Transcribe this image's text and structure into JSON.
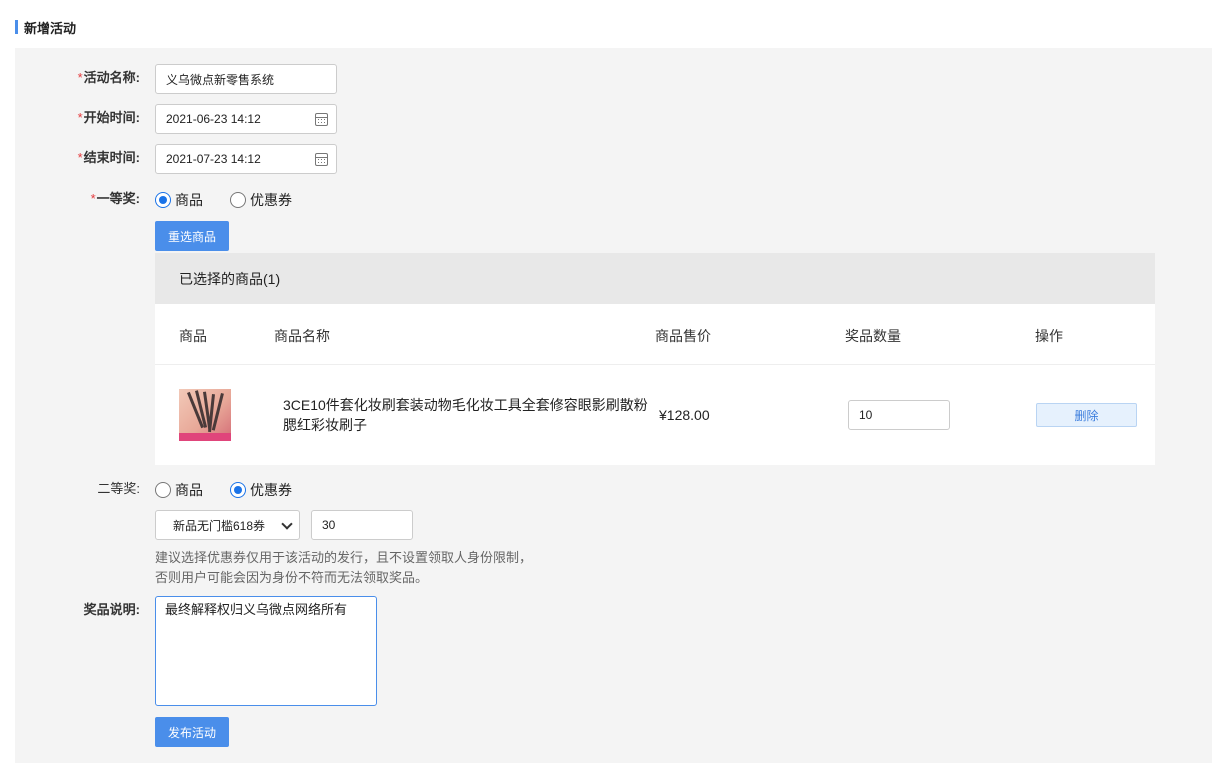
{
  "header": {
    "title": "新增活动"
  },
  "form": {
    "required_mark": "*",
    "name": {
      "label": "活动名称:",
      "value": "义乌微点新零售系统"
    },
    "start_time": {
      "label": "开始时间:",
      "value": "2021-06-23 14:12"
    },
    "end_time": {
      "label": "结束时间:",
      "value": "2021-07-23 14:12"
    },
    "first_prize": {
      "label": "一等奖:",
      "options": [
        "商品",
        "优惠券"
      ],
      "selected": "商品",
      "reselect_label": "重选商品",
      "table": {
        "caption": "已选择的商品(1)",
        "columns": [
          "商品",
          "商品名称",
          "商品售价",
          "奖品数量",
          "操作"
        ],
        "rows": [
          {
            "name": "3CE10件套化妆刷套装动物毛化妆工具全套修容眼影刷散粉腮红彩妆刷子",
            "price": "¥128.00",
            "quantity": "10",
            "action": "删除"
          }
        ]
      }
    },
    "second_prize": {
      "label": "二等奖:",
      "options": [
        "商品",
        "优惠券"
      ],
      "selected": "优惠券",
      "coupon_select": "新品无门槛618券",
      "coupon_count": "30",
      "hint_lines": [
        "建议选择优惠券仅用于该活动的发行，且不设置领取人身份限制，",
        "否则用户可能会因为身份不符而无法领取奖品。"
      ]
    },
    "description": {
      "label": "奖品说明:",
      "value": "最终解释权归义乌微点网络所有"
    },
    "submit_label": "发布活动"
  },
  "colors": {
    "accent": "#4a8eea",
    "required": "#e4393c",
    "radio": "#1a73e8",
    "form_bg": "#f4f4f4"
  },
  "icons": {
    "date": "calendar-icon",
    "select": "chevron-down-icon",
    "product": "product-thumbnail"
  }
}
